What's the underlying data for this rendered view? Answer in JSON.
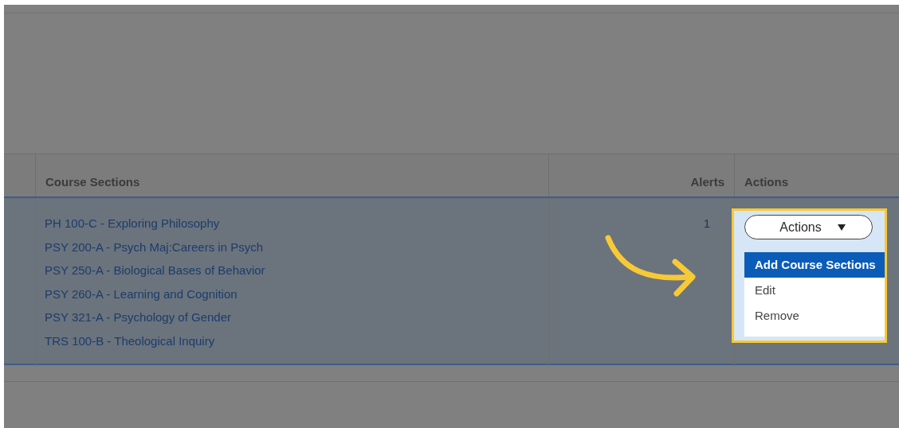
{
  "table": {
    "columns": [
      "Course Sections",
      "Alerts",
      "Actions"
    ],
    "rows": [
      {
        "selected": true,
        "course_sections": [
          "PH 100-C - Exploring Philosophy",
          "PSY 200-A - Psych Maj:Careers in Psych",
          "PSY 250-A - Biological Bases of Behavior",
          "PSY 260-A - Learning and Cognition",
          "PSY 321-A - Psychology of Gender",
          "TRS 100-B - Theological Inquiry"
        ],
        "alerts": "1",
        "actions_button": {
          "label": "Actions",
          "expanded": true
        },
        "menu": [
          {
            "label": "Add Course Sections",
            "selected": true
          },
          {
            "label": "Edit",
            "selected": false
          },
          {
            "label": "Remove",
            "selected": false
          }
        ]
      }
    ]
  }
}
